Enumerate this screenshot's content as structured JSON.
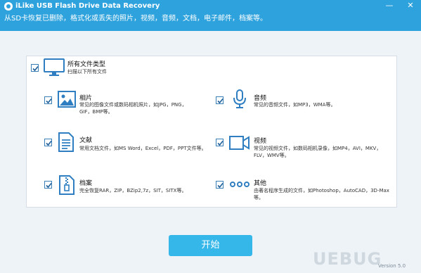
{
  "window": {
    "title": "iLike USB Flash Drive Data Recovery",
    "subtitle": "从SD卡恢复已删除，格式化或丢失的照片，视频，音频，文档，电子邮件，档案等。",
    "minimize_glyph": "—",
    "close_glyph": "✕"
  },
  "all_types": {
    "title": "所有文件类型",
    "desc": "扫描以下所有文件",
    "icon": "monitor-icon",
    "checked": true
  },
  "file_types": [
    {
      "key": "photos",
      "title": "相片",
      "desc": "常见的图像文件或数码相机照片，如JPG，PNG，GIF，BMP等。",
      "icon": "image-icon",
      "checked": true
    },
    {
      "key": "audio",
      "title": "音频",
      "desc": "常见的音频文件，如MP3，WMA等。",
      "icon": "microphone-icon",
      "checked": true
    },
    {
      "key": "documents",
      "title": "文献",
      "desc": "常用文档文件，如MS Word，Excel，PDF，PPT文件等。",
      "icon": "document-icon",
      "checked": true
    },
    {
      "key": "video",
      "title": "视频",
      "desc": "常见的视频文件，如数码相机录像，如MP4，AVI，MKV，FLV，WMV等。",
      "icon": "video-camera-icon",
      "checked": true
    },
    {
      "key": "archives",
      "title": "档案",
      "desc": "完全恢复RAR，ZIP，BZip2,7z，SIT，SITX等。",
      "icon": "zip-file-icon",
      "checked": true
    },
    {
      "key": "others",
      "title": "其他",
      "desc": "由著名程序生成的文件，如Photoshop，AutoCAD，3D-Max等。",
      "icon": "more-dots-icon",
      "checked": true
    }
  ],
  "start_button": "开始",
  "version": "Version 5.0",
  "watermark": "UEBUG",
  "colors": {
    "header": "#2ea2dc",
    "accent": "#35b7ea",
    "icon": "#2f7ec1"
  }
}
